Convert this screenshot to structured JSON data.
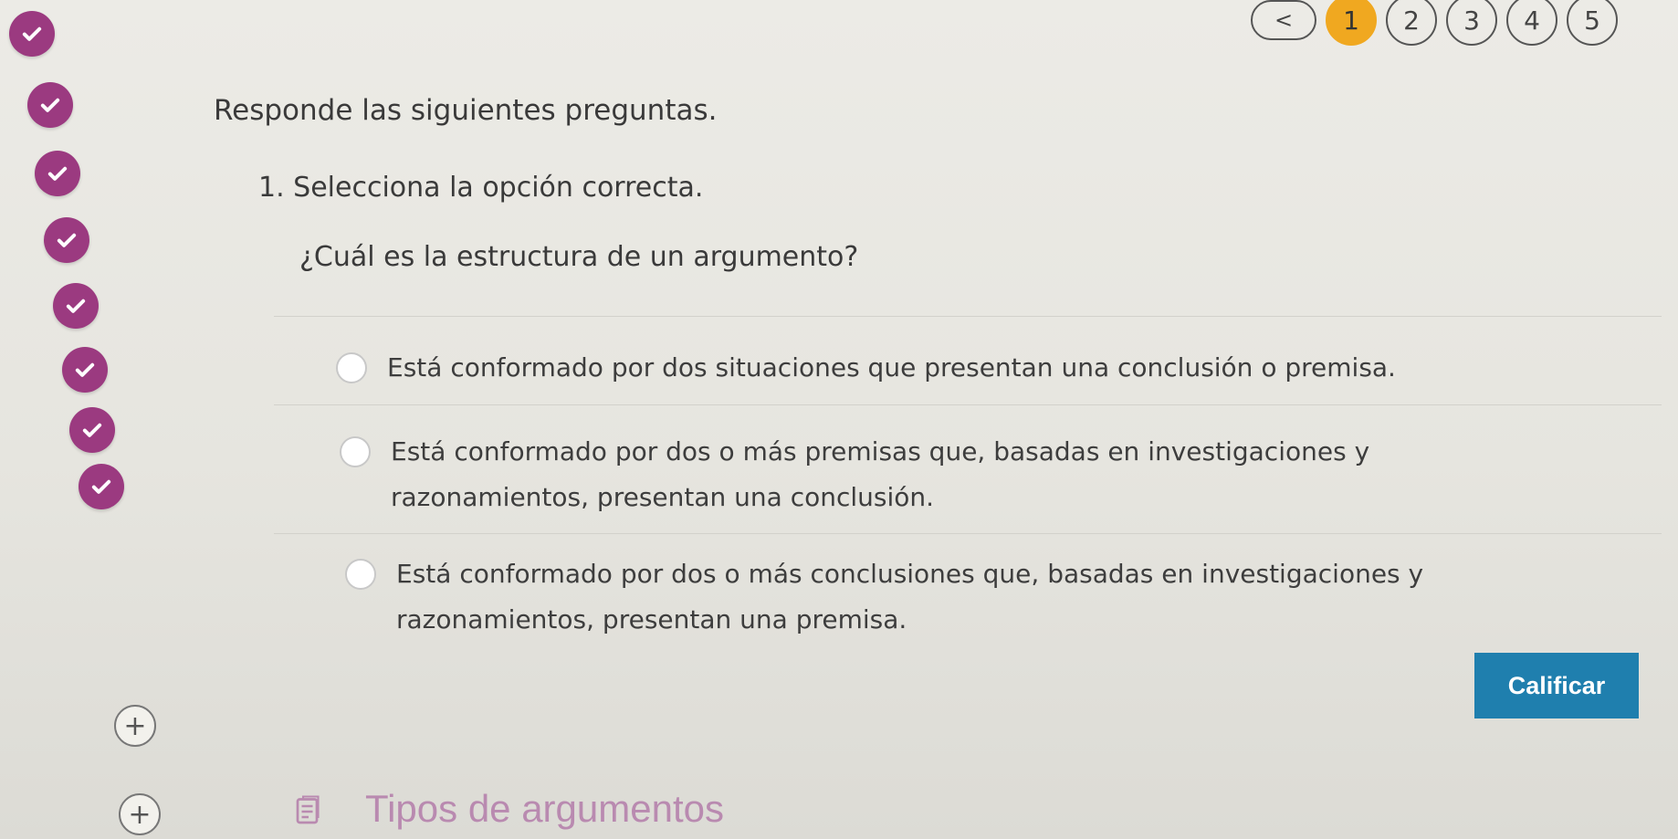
{
  "pager": {
    "prev_label": "<",
    "pages": [
      "1",
      "2",
      "3",
      "4",
      "5"
    ],
    "active_page": "1"
  },
  "instructions": "Responde las siguientes preguntas.",
  "question": {
    "number_label": "1. Selecciona la opción correcta.",
    "text": "¿Cuál es la estructura de un argumento?",
    "options": [
      "Está conformado por dos situaciones que presentan una conclusión o premisa.",
      "Está conformado por dos o más premisas que, basadas en investigaciones y razonamientos, presentan una conclusión.",
      "Está conformado por dos o más conclusiones que, basadas en investigaciones y razonamientos, presentan una premisa."
    ]
  },
  "grade_button": "Calificar",
  "section": {
    "title": "Tipos de argumentos",
    "icon": "document-icon"
  },
  "progress": {
    "completed_count": 8,
    "icon": "check-icon"
  },
  "colors": {
    "check": "#9b3a80",
    "active_page": "#f0a820",
    "grade_button": "#1f7fae",
    "section_title": "#b98ab0"
  }
}
